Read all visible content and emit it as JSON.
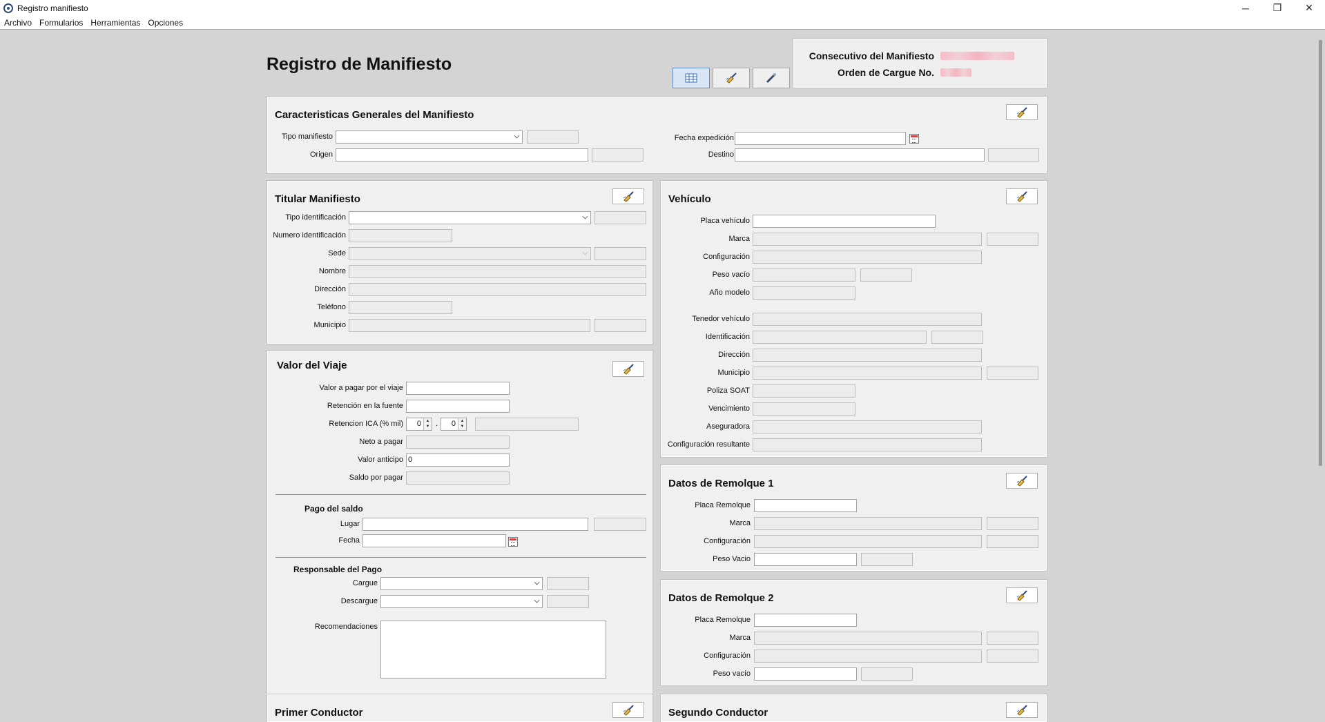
{
  "window": {
    "title": "Registro manifiesto",
    "minimize": "─",
    "maximize": "❐",
    "close": "✕"
  },
  "menu": [
    "Archivo",
    "Formularios",
    "Herramientas",
    "Opciones"
  ],
  "page": {
    "title": "Registro de Manifiesto"
  },
  "header": {
    "consecutivo_label": "Consecutivo del Manifiesto",
    "orden_label": "Orden de Cargue No."
  },
  "general": {
    "title": "Caracteristicas Generales del Manifiesto",
    "tipo_manifiesto": "Tipo manifiesto",
    "origen": "Origen",
    "fecha_expedicion": "Fecha expedición",
    "destino": "Destino"
  },
  "titular": {
    "title": "Titular Manifiesto",
    "tipo_identificacion": "Tipo identificación",
    "numero_identificacion": "Numero identificación",
    "sede": "Sede",
    "nombre": "Nombre",
    "direccion": "Dirección",
    "telefono": "Teléfono",
    "municipio": "Municipio"
  },
  "valor": {
    "title": "Valor del Viaje",
    "valor_pagar": "Valor a pagar por el viaje",
    "retencion_fuente": "Retención en la fuente",
    "retencion_ica": "Retencion ICA (% mil)",
    "ica_a": "0",
    "ica_dot": ".",
    "ica_b": "0",
    "neto": "Neto a pagar",
    "anticipo": "Valor anticipo",
    "anticipo_value": "0",
    "saldo": "Saldo por pagar",
    "pago_saldo": "Pago del saldo",
    "lugar": "Lugar",
    "fecha": "Fecha",
    "responsable": "Responsable del Pago",
    "cargue": "Cargue",
    "descargue": "Descargue",
    "recomendaciones": "Recomendaciones"
  },
  "vehiculo": {
    "title": "Vehículo",
    "placa": "Placa vehículo",
    "marca": "Marca",
    "configuracion": "Configuración",
    "peso_vacio": "Peso vacío",
    "anio_modelo": "Año modelo",
    "tenedor": "Tenedor vehículo",
    "identificacion": "Identificación",
    "direccion": "Dirección",
    "municipio": "Municipio",
    "poliza": "Poliza SOAT",
    "vencimiento": "Vencimiento",
    "aseguradora": "Aseguradora",
    "config_resultante": "Configuración resultante"
  },
  "remolque1": {
    "title": "Datos de Remolque 1",
    "placa": "Placa Remolque",
    "marca": "Marca",
    "configuracion": "Configuración",
    "peso": "Peso Vacio"
  },
  "remolque2": {
    "title": "Datos de Remolque 2",
    "placa": "Placa Remolque",
    "marca": "Marca",
    "configuracion": "Configuración",
    "peso": "Peso vacío"
  },
  "conductor1": {
    "title": "Primer Conductor"
  },
  "conductor2": {
    "title": "Segundo Conductor"
  }
}
